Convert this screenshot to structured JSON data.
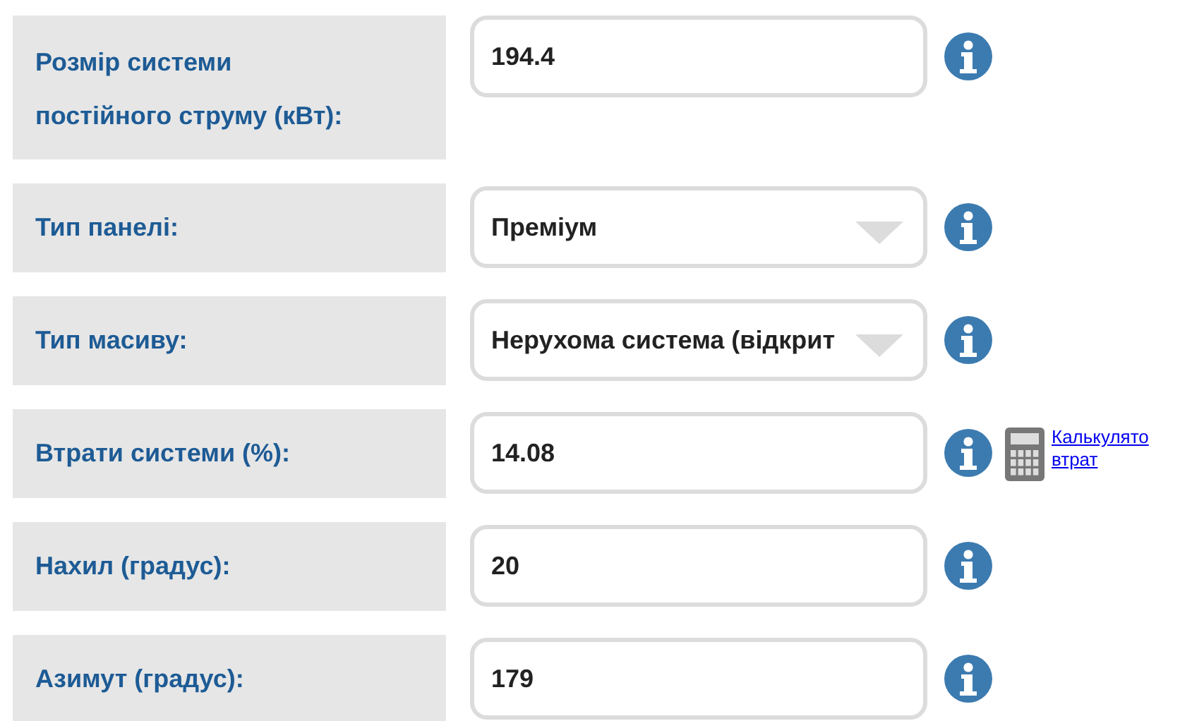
{
  "fields": [
    {
      "label": "Розмір системи постійного струму (кВт):",
      "kind": "text",
      "value": "194.4"
    },
    {
      "label": "Тип панелі:",
      "kind": "select",
      "value": "Преміум"
    },
    {
      "label": "Тип масиву:",
      "kind": "select",
      "value": "Нерухома система (відкрит"
    },
    {
      "label": "Втрати системи (%):",
      "kind": "text",
      "value": "14.08",
      "link": "Калькулято втрат"
    },
    {
      "label": "Нахил (градус):",
      "kind": "text",
      "value": "20"
    },
    {
      "label": "Азимут (градус):",
      "kind": "text",
      "value": "179"
    }
  ]
}
